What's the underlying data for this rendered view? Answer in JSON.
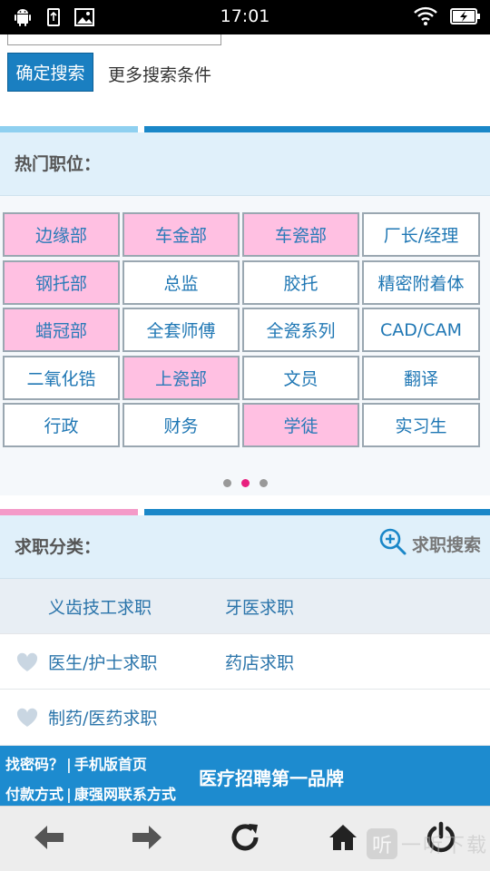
{
  "status_bar": {
    "time": "17:01",
    "left_icons": [
      "android-icon",
      "usb-icon",
      "image-icon"
    ],
    "right_icons": [
      "wifi-icon",
      "battery-charging-icon"
    ]
  },
  "search": {
    "confirm_label": "确定搜索",
    "more_label": "更多搜索条件"
  },
  "hot_jobs": {
    "title": "热门职位：",
    "items": [
      {
        "label": "边缘部",
        "highlight": true
      },
      {
        "label": "车金部",
        "highlight": true
      },
      {
        "label": "车瓷部",
        "highlight": true
      },
      {
        "label": "厂长/经理",
        "highlight": false
      },
      {
        "label": "钢托部",
        "highlight": true
      },
      {
        "label": "总监",
        "highlight": false
      },
      {
        "label": "胶托",
        "highlight": false
      },
      {
        "label": "精密附着体",
        "highlight": false
      },
      {
        "label": "蜡冠部",
        "highlight": true
      },
      {
        "label": "全套师傅",
        "highlight": false
      },
      {
        "label": "全瓷系列",
        "highlight": false
      },
      {
        "label": "CAD/CAM",
        "highlight": false
      },
      {
        "label": "二氧化锆",
        "highlight": false
      },
      {
        "label": "上瓷部",
        "highlight": true
      },
      {
        "label": "文员",
        "highlight": false
      },
      {
        "label": "翻译",
        "highlight": false
      },
      {
        "label": "行政",
        "highlight": false
      },
      {
        "label": "财务",
        "highlight": false
      },
      {
        "label": "学徒",
        "highlight": true
      },
      {
        "label": "实习生",
        "highlight": false
      }
    ],
    "page_count": 3,
    "active_page": 2
  },
  "job_categories": {
    "title": "求职分类：",
    "search_label": "求职搜索",
    "rows": [
      {
        "left": "义齿技工求职",
        "right": "牙医求职"
      },
      {
        "left": "医生/护士求职",
        "right": "药店求职"
      },
      {
        "left": "制药/医药求职",
        "right": ""
      }
    ]
  },
  "footer": {
    "link_forgot": "找密码？",
    "link_mobile_home": "手机版首页",
    "link_payment": "付款方式",
    "link_contact": "康强网联系方式",
    "separator": "|",
    "slogan": "医疗招聘第一品牌"
  },
  "bottom_nav": {
    "icons": [
      "back-arrow-icon",
      "forward-arrow-icon",
      "refresh-icon",
      "home-icon",
      "power-icon"
    ]
  },
  "watermark": {
    "logo_char": "听",
    "text": "一听下载"
  },
  "colors": {
    "accent_blue": "#1a87c8",
    "pink_highlight": "#ffc0e2",
    "dot_active": "#e8207f",
    "section_bg": "#e0f0fa"
  }
}
